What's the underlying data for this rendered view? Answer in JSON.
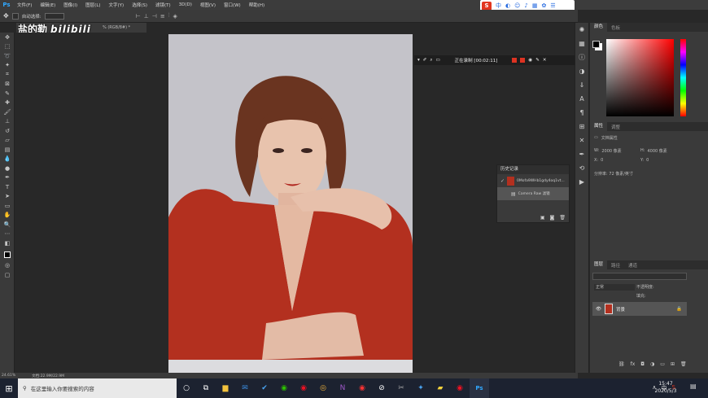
{
  "app": {
    "logo": "Ps"
  },
  "menu": [
    "文件(F)",
    "编辑(E)",
    "图像(I)",
    "图层(L)",
    "文字(Y)",
    "选择(S)",
    "滤镜(T)",
    "3D(D)",
    "视图(V)",
    "窗口(W)",
    "帮助(H)"
  ],
  "options_bar": {
    "auto_select_label": "自动选择:"
  },
  "watermark": {
    "name": "盐的勒",
    "site": "bilibili"
  },
  "document_tab": {
    "title": "% (RGB/8#) *"
  },
  "recorder": {
    "status": "正在录制 [00:02:11]"
  },
  "history_panel": {
    "title": "历史记录",
    "snapshot": "0Mofa9WHb1gdy4oq1vt...",
    "step": "Camera Raw 滤镜"
  },
  "color_panel": {
    "tabs": [
      "颜色",
      "色板"
    ]
  },
  "properties_panel": {
    "tabs": [
      "属性",
      "调整"
    ],
    "section": "文档属性",
    "width_label": "W:",
    "width_value": "2000 像素",
    "height_label": "H:",
    "height_value": "4000 像素",
    "x_label": "X:",
    "x_value": "0",
    "y_label": "Y:",
    "y_value": "0",
    "resolution": "分辨率: 72 像素/英寸"
  },
  "layers_panel": {
    "tabs": [
      "图层",
      "路径",
      "通道"
    ],
    "kind_label": "正常",
    "opacity_label": "不透明度:",
    "fill_label": "填充:",
    "layer_name": "背景"
  },
  "status_bar": {
    "zoom": "24.61%",
    "doc_size": "文档:22.9M/22.9M"
  },
  "taskbar": {
    "search_placeholder": "在这里输入你要搜索的内容",
    "time": "15:47",
    "date": "2020/5/3",
    "ime": "中"
  },
  "ime_toolbar": {
    "logo": "S",
    "mode": "中"
  }
}
